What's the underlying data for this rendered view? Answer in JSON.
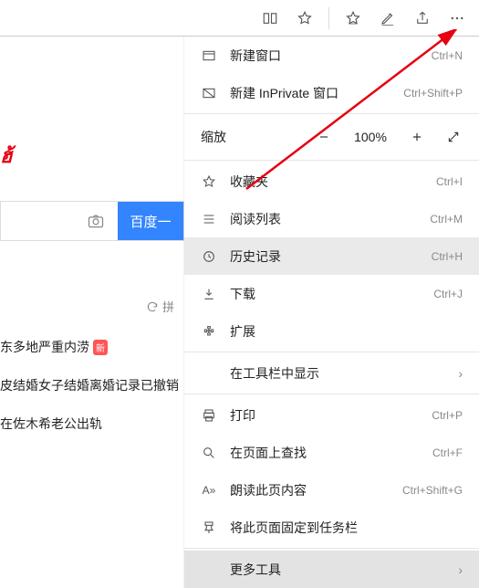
{
  "page_background": {
    "logo_fragment": "ฮ้",
    "search_button": "百度一",
    "refresh_hint": "拼",
    "news": [
      {
        "text": "东多地严重内涝",
        "badge": "新"
      },
      {
        "text": "皮结婚女子结婚离婚记录已撤销",
        "badge": ""
      },
      {
        "text": "在佐木希老公出轨",
        "badge": ""
      }
    ]
  },
  "toolbar": {
    "reading": "reading-view",
    "star": "favorite",
    "fav": "favorites-hub",
    "pen": "notes",
    "share": "share",
    "more": "more"
  },
  "menu": {
    "new_window": {
      "label": "新建窗口",
      "shortcut": "Ctrl+N"
    },
    "new_inprivate": {
      "label": "新建 InPrivate 窗口",
      "shortcut": "Ctrl+Shift+P"
    },
    "zoom": {
      "label": "缩放",
      "value": "100%"
    },
    "favorites": {
      "label": "收藏夹",
      "shortcut": "Ctrl+I"
    },
    "reading_list": {
      "label": "阅读列表",
      "shortcut": "Ctrl+M"
    },
    "history": {
      "label": "历史记录",
      "shortcut": "Ctrl+H"
    },
    "downloads": {
      "label": "下载",
      "shortcut": "Ctrl+J"
    },
    "extensions": {
      "label": "扩展",
      "shortcut": ""
    },
    "show_in_toolbar": {
      "label": "在工具栏中显示",
      "shortcut": ""
    },
    "print": {
      "label": "打印",
      "shortcut": "Ctrl+P"
    },
    "find": {
      "label": "在页面上查找",
      "shortcut": "Ctrl+F"
    },
    "read_aloud": {
      "label": "朗读此页内容",
      "shortcut": "Ctrl+Shift+G"
    },
    "pin": {
      "label": "将此页面固定到任务栏",
      "shortcut": ""
    },
    "more_tools": {
      "label": "更多工具",
      "shortcut": ""
    }
  }
}
